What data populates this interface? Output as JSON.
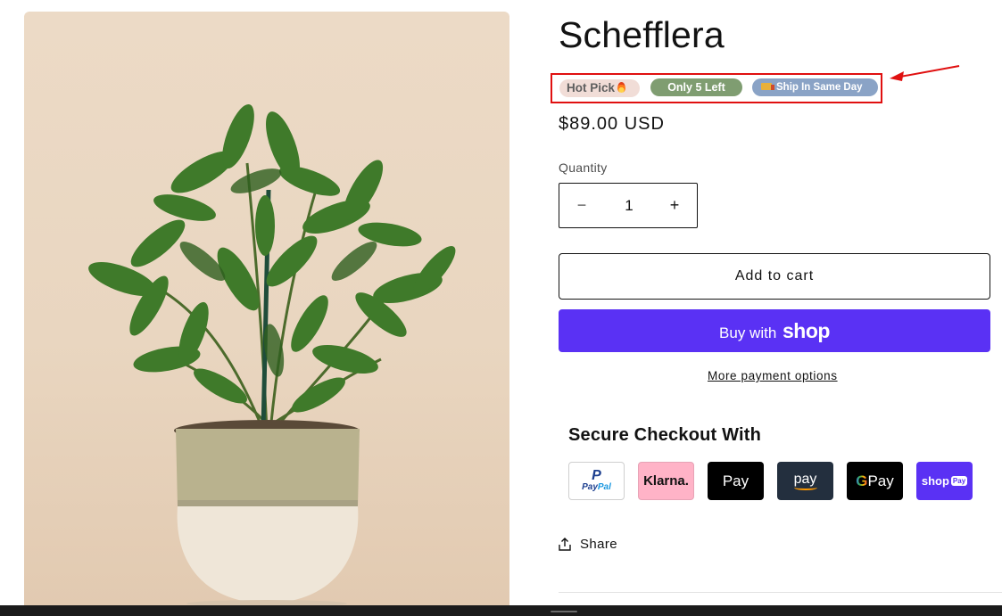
{
  "product": {
    "title": "Schefflera",
    "badges": {
      "hot_pick": "Hot Pick",
      "stock": "Only 5 Left",
      "shipping": "Ship In Same Day"
    },
    "price": "$89.00 USD",
    "quantity_label": "Quantity",
    "quantity_value": "1",
    "decrement_symbol": "−",
    "increment_symbol": "+"
  },
  "actions": {
    "add_to_cart": "Add to cart",
    "buy_with": "Buy with",
    "shop_logo": "shop",
    "more_payment_options": "More payment options",
    "share": "Share"
  },
  "checkout": {
    "heading": "Secure Checkout With",
    "methods": {
      "paypal_mark": "P",
      "paypal_pay": "Pay",
      "paypal_pal": "Pal",
      "klarna": "Klarna.",
      "apple_logo": "",
      "apple_pay": "Pay",
      "amazon_pay": "pay",
      "google_g": "G",
      "google_pay": "Pay",
      "shop_pay": "shop",
      "shop_pay_pill": "Pay"
    }
  },
  "colors": {
    "annotation_red": "#e01010",
    "shop_purple": "#5a31f4",
    "stock_badge": "#7f9d71",
    "ship_badge": "#8aa3c6",
    "hot_badge": "#f1ddd7"
  },
  "icons": {
    "share": "share-icon",
    "annotation": "red-arrow-icon",
    "flame": "fire-icon",
    "truck": "truck-icon"
  }
}
